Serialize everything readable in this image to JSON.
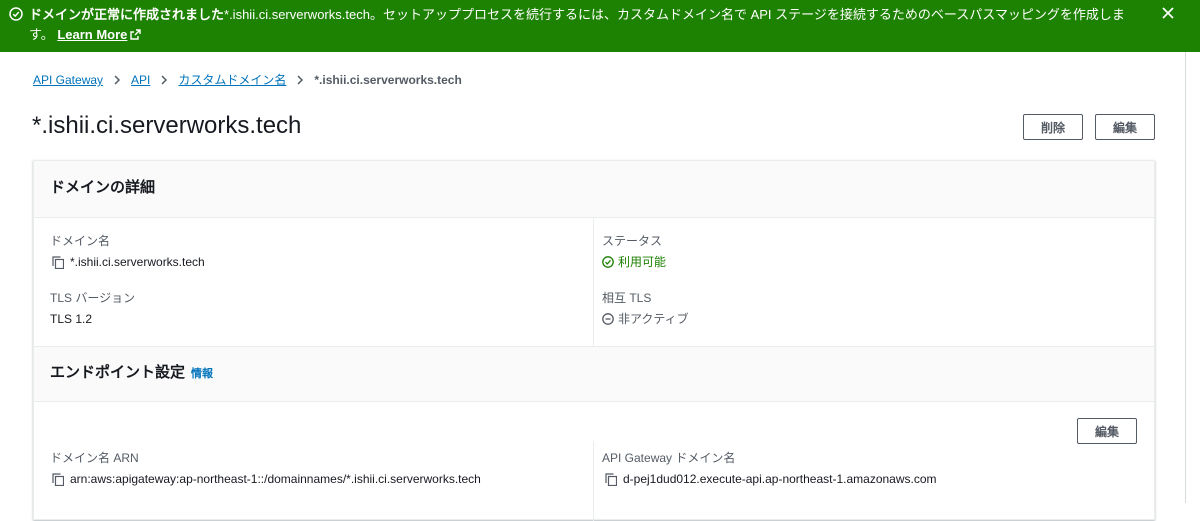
{
  "flash": {
    "bold_text": "ドメインが正常に作成されました",
    "domain": "*.ishii.ci.serverworks.tech",
    "message": "。セットアッププロセスを続行するには、カスタムドメイン名で API ステージを接続するためのベースパスマッピングを作成します。",
    "learn_more": "Learn More",
    "color": "#1d8102"
  },
  "breadcrumb": {
    "items": [
      "API Gateway",
      "API",
      "カスタムドメイン名"
    ],
    "current": "*.ishii.ci.serverworks.tech"
  },
  "page": {
    "title": "*.ishii.ci.serverworks.tech",
    "delete_label": "削除",
    "edit_label": "編集"
  },
  "domain_details": {
    "title": "ドメインの詳細",
    "domain_name_label": "ドメイン名",
    "domain_name_value": "*.ishii.ci.serverworks.tech",
    "status_label": "ステータス",
    "status_value": "利用可能",
    "tls_label": "TLS バージョン",
    "tls_value": "TLS 1.2",
    "mutual_tls_label": "相互 TLS",
    "mutual_tls_value": "非アクティブ"
  },
  "endpoint": {
    "title": "エンドポイント設定",
    "info_label": "情報",
    "edit_label": "編集",
    "arn_label": "ドメイン名 ARN",
    "arn_value": "arn:aws:apigateway:ap-northeast-1::/domainnames/*.ishii.ci.serverworks.tech",
    "gateway_domain_label": "API Gateway ドメイン名",
    "gateway_domain_value": "d-pej1dud012.execute-api.ap-northeast-1.amazonaws.com"
  },
  "colors": {
    "link": "#0073bb",
    "success": "#1d8102",
    "text": "#16191f",
    "muted": "#545b64"
  }
}
